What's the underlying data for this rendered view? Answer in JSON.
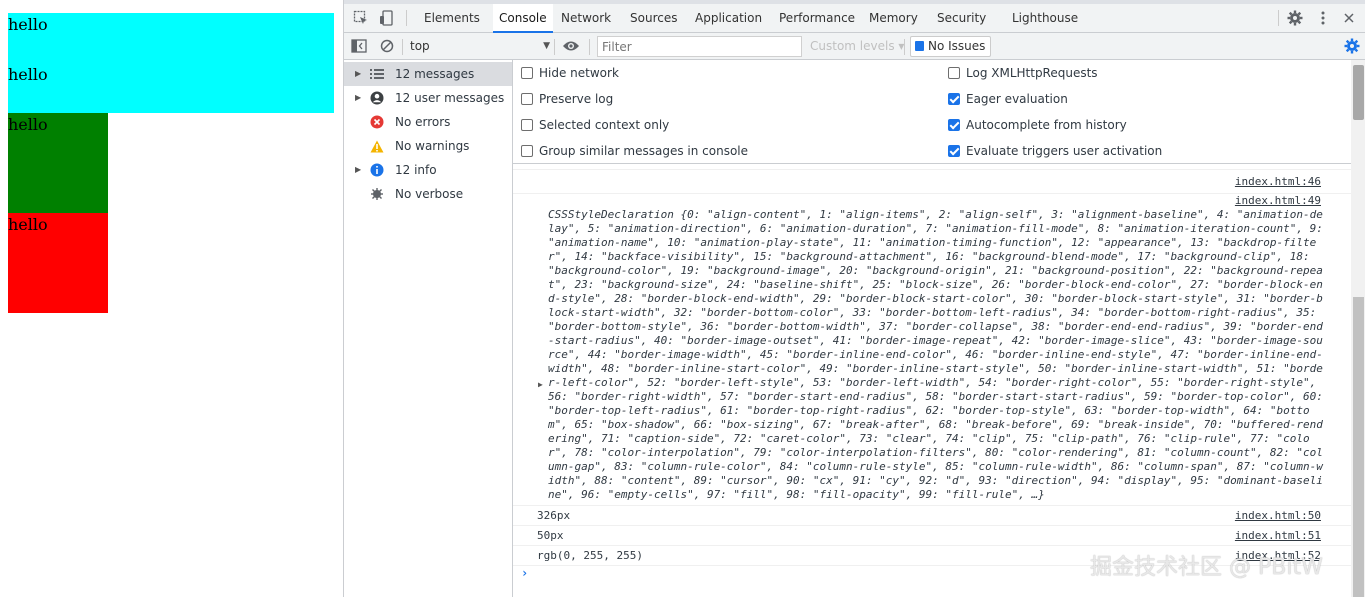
{
  "preview": {
    "boxes": [
      {
        "lines": [
          "hello",
          "hello"
        ],
        "color": "#00ffff"
      },
      {
        "lines": [
          "hello"
        ],
        "color": "#008000"
      },
      {
        "lines": [
          "hello"
        ],
        "color": "#ff0000"
      }
    ]
  },
  "devtools": {
    "tabs": [
      "Elements",
      "Console",
      "Sources",
      "Network",
      "Application",
      "Performance",
      "Memory",
      "Security",
      "Lighthouse"
    ],
    "active_tab": "Console",
    "icons": [
      "inspect-icon",
      "device-toolbar-icon",
      "settings-gear-icon",
      "kebab-menu-icon"
    ],
    "toolbar": {
      "context": "top",
      "filter_placeholder": "Filter",
      "custom_levels": "Custom levels ▾",
      "no_issues": "No Issues"
    },
    "sidebar": [
      {
        "label": "12 messages",
        "icon": "list-icon",
        "expandable": true,
        "selected": true
      },
      {
        "label": "12 user messages",
        "icon": "user-icon",
        "expandable": true
      },
      {
        "label": "No errors",
        "icon": "error-icon"
      },
      {
        "label": "No warnings",
        "icon": "warning-icon"
      },
      {
        "label": "12 info",
        "icon": "info-icon",
        "expandable": true
      },
      {
        "label": "No verbose",
        "icon": "bug-icon"
      }
    ],
    "settings": {
      "left": [
        {
          "label": "Hide network",
          "checked": false
        },
        {
          "label": "Preserve log",
          "checked": false
        },
        {
          "label": "Selected context only",
          "checked": false
        },
        {
          "label": "Group similar messages in console",
          "checked": false
        }
      ],
      "right": [
        {
          "label": "Log XMLHttpRequests",
          "checked": false
        },
        {
          "label": "Eager evaluation",
          "checked": true
        },
        {
          "label": "Autocomplete from history",
          "checked": true
        },
        {
          "label": "Evaluate triggers user activation",
          "checked": true
        }
      ]
    },
    "messages": [
      {
        "source": "index.html:46",
        "text": ""
      },
      {
        "source": "index.html:49",
        "text": "CSSStyleDeclaration {0: \"align-content\", 1: \"align-items\", 2: \"align-self\", 3: \"alignment-baseline\", 4: \"animation-delay\", 5: \"animation-direction\", 6: \"animation-duration\", 7: \"animation-fill-mode\", 8: \"animation-iteration-count\", 9: \"animation-name\", 10: \"animation-play-state\", 11: \"animation-timing-function\", 12: \"appearance\", 13: \"backdrop-filter\", 14: \"backface-visibility\", 15: \"background-attachment\", 16: \"background-blend-mode\", 17: \"background-clip\", 18: \"background-color\", 19: \"background-image\", 20: \"background-origin\", 21: \"background-position\", 22: \"background-repeat\", 23: \"background-size\", 24: \"baseline-shift\", 25: \"block-size\", 26: \"border-block-end-color\", 27: \"border-block-end-style\", 28: \"border-block-end-width\", 29: \"border-block-start-color\", 30: \"border-block-start-style\", 31: \"border-block-start-width\", 32: \"border-bottom-color\", 33: \"border-bottom-left-radius\", 34: \"border-bottom-right-radius\", 35: \"border-bottom-style\", 36: \"border-bottom-width\", 37: \"border-collapse\", 38: \"border-end-end-radius\", 39: \"border-end-start-radius\", 40: \"border-image-outset\", 41: \"border-image-repeat\", 42: \"border-image-slice\", 43: \"border-image-source\", 44: \"border-image-width\", 45: \"border-inline-end-color\", 46: \"border-inline-end-style\", 47: \"border-inline-end-width\", 48: \"border-inline-start-color\", 49: \"border-inline-start-style\", 50: \"border-inline-start-width\", 51: \"border-left-color\", 52: \"border-left-style\", 53: \"border-left-width\", 54: \"border-right-color\", 55: \"border-right-style\", 56: \"border-right-width\", 57: \"border-start-end-radius\", 58: \"border-start-start-radius\", 59: \"border-top-color\", 60: \"border-top-left-radius\", 61: \"border-top-right-radius\", 62: \"border-top-style\", 63: \"border-top-width\", 64: \"bottom\", 65: \"box-shadow\", 66: \"box-sizing\", 67: \"break-after\", 68: \"break-before\", 69: \"break-inside\", 70: \"buffered-rendering\", 71: \"caption-side\", 72: \"caret-color\", 73: \"clear\", 74: \"clip\", 75: \"clip-path\", 76: \"clip-rule\", 77: \"color\", 78: \"color-interpolation\", 79: \"color-interpolation-filters\", 80: \"color-rendering\", 81: \"column-count\", 82: \"column-gap\", 83: \"column-rule-color\", 84: \"column-rule-style\", 85: \"column-rule-width\", 86: \"column-span\", 87: \"column-width\", 88: \"content\", 89: \"cursor\", 90: \"cx\", 91: \"cy\", 92: \"d\", 93: \"direction\", 94: \"display\", 95: \"dominant-baseline\", 96: \"empty-cells\", 97: \"fill\", 98: \"fill-opacity\", 99: \"fill-rule\", …}"
      },
      {
        "source": "index.html:50",
        "text": "326px"
      },
      {
        "source": "index.html:51",
        "text": "50px"
      },
      {
        "source": "index.html:52",
        "text": "rgb(0, 255, 255)"
      }
    ],
    "prompt_symbol": "›"
  },
  "watermark": "掘金技术社区 @ PBitW"
}
